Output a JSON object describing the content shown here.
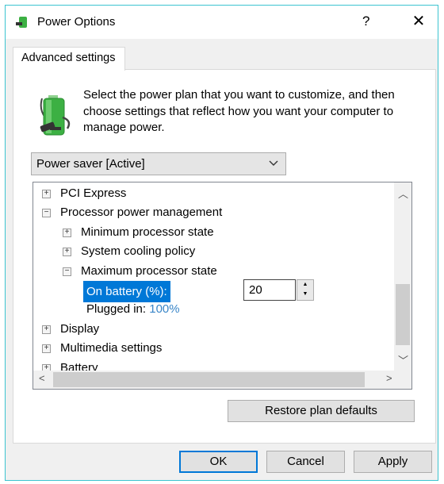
{
  "window": {
    "title": "Power Options",
    "help_label": "?",
    "close_label": "✕",
    "icon": "power-plug-battery-icon"
  },
  "tab": {
    "label": "Advanced settings"
  },
  "description": "Select the power plan that you want to customize, and then choose settings that reflect how you want your computer to manage power.",
  "plan_dropdown": {
    "value": "Power saver [Active]"
  },
  "tree": {
    "items": [
      {
        "label": "PCI Express",
        "expanded": false
      },
      {
        "label": "Processor power management",
        "expanded": true
      },
      {
        "label": "Minimum processor state",
        "expanded": false
      },
      {
        "label": "System cooling policy",
        "expanded": false
      },
      {
        "label": "Maximum processor state",
        "expanded": true
      },
      {
        "label": "Display",
        "expanded": false
      },
      {
        "label": "Multimedia settings",
        "expanded": false
      },
      {
        "label": "Battery",
        "expanded": false
      }
    ],
    "on_battery_label": "On battery (%):",
    "on_battery_value": "20",
    "plugged_in_label": "Plugged in:",
    "plugged_in_value": "100%"
  },
  "buttons": {
    "restore": "Restore plan defaults",
    "ok": "OK",
    "cancel": "Cancel",
    "apply": "Apply"
  },
  "colors": {
    "accent": "#0078d7",
    "link_value": "#3a86c8"
  }
}
